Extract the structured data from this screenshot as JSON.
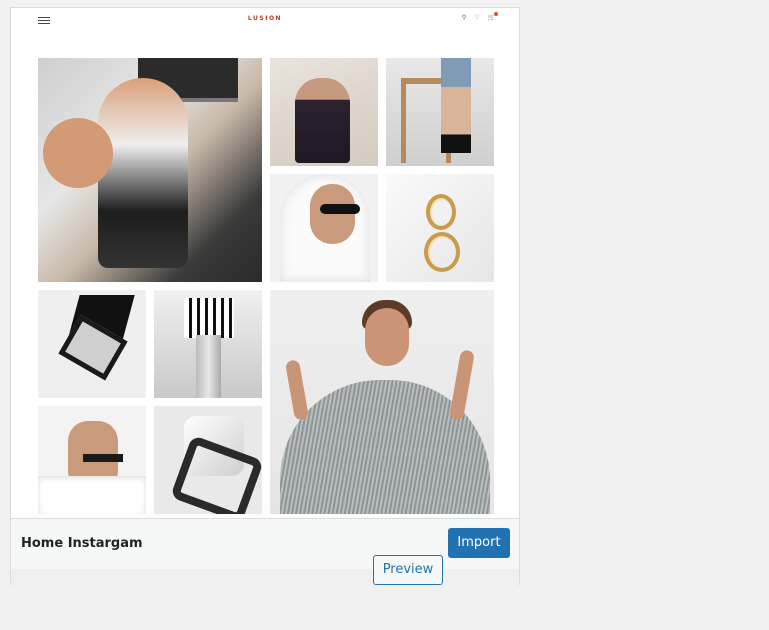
{
  "theme_preview": {
    "logo": "LUSION",
    "header_icons": [
      "menu-icon",
      "search-icon",
      "heart-icon",
      "cart-icon"
    ],
    "tiles": [
      {
        "name": "woman-with-radio-photo"
      },
      {
        "name": "woman-in-black-top-photo"
      },
      {
        "name": "legs-on-stool-photo"
      },
      {
        "name": "woman-hood-sunglasses-photo"
      },
      {
        "name": "gold-earrings-photo"
      },
      {
        "name": "black-bag-buckle-photo"
      },
      {
        "name": "piano-skirt-photo"
      },
      {
        "name": "woman-pleated-dress-photo"
      },
      {
        "name": "woman-choker-photo"
      },
      {
        "name": "black-handbag-photo"
      }
    ]
  },
  "footer": {
    "theme_name": "Home Instargam",
    "import_label": "Import",
    "preview_label": "Preview"
  },
  "colors": {
    "primary_button": "#2271b1",
    "background": "#f1f1f1",
    "logo_accent": "#c0392b"
  }
}
